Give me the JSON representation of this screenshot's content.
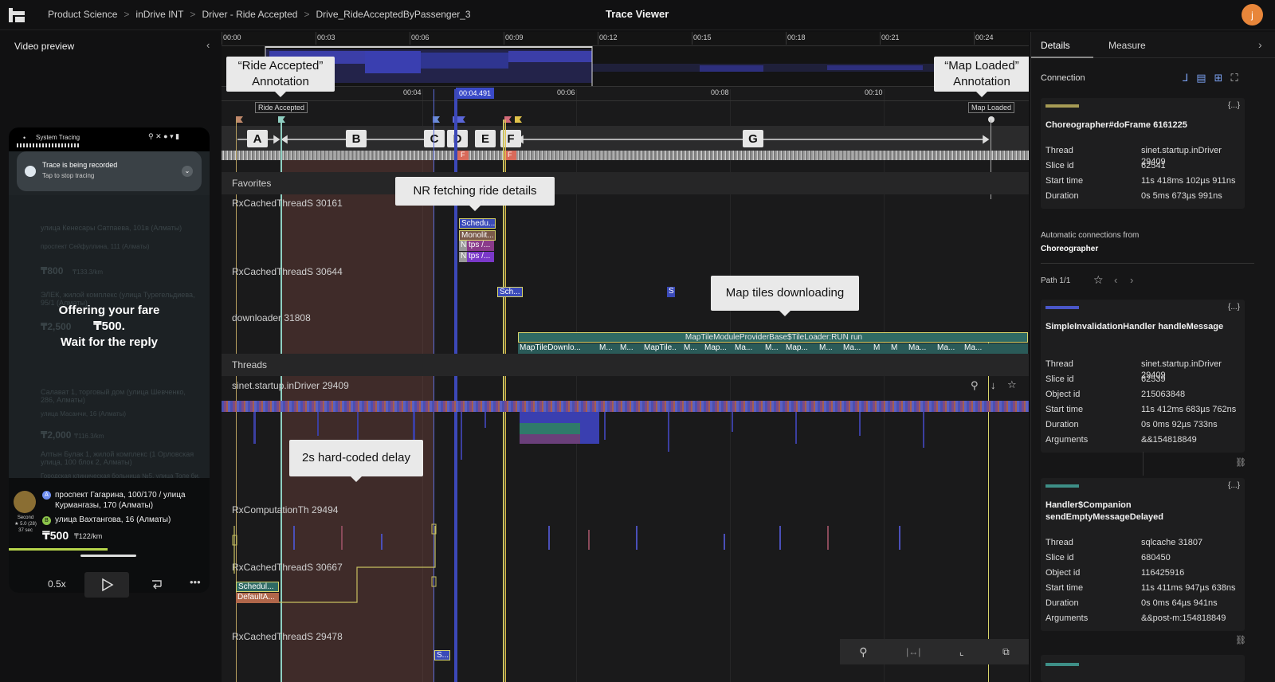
{
  "topbar": {
    "breadcrumbs": [
      "Product Science",
      "inDrive INT",
      "Driver - Ride Accepted",
      "Drive_RideAcceptedByPassenger_3"
    ],
    "title": "Trace Viewer",
    "avatar_initial": "j"
  },
  "video_preview": {
    "title": "Video preview",
    "speed": "0.5x",
    "phone": {
      "notif_app": "System Tracing",
      "notif_title": "Trace is being recorded",
      "notif_sub": "Tap to stop tracing",
      "offer_line1": "Offering your fare",
      "offer_line2": "₸500.",
      "offer_line3": "Wait for the reply",
      "bg_row1": "улица Кенесары Сатпаева, 101в (Алматы)",
      "bg_row1b": "проспект Сейфуллина, 111 (Алматы)",
      "bg_price1": "₸800",
      "bg_price1b": "₸133.3/km",
      "bg_row2": "ЭЛЕК, жилой комплекс (улица Турегельдиева, 95/1 (Алматы)",
      "bg_price2": "₸2,500",
      "bg_row3": "Салават 1, торговый дом (улица Шевченко, 286, Алматы)",
      "bg_row3b": "улица Масанчи, 16 (Алматы)",
      "bg_price3": "₸2,000",
      "bg_price3b": "₸116.3/km",
      "bg_row4": "Алтын Булак 1, жилой комплекс (1 Орловская улица, 100 блок 2, Алматы)",
      "bg_row4b": "Городская клиническая больница №5, улица Толе би, 253 (Алматы)",
      "driver_badge": "Second",
      "driver_rating": "★ 5.0 (28)",
      "driver_time": "37 sec",
      "from": "проспект Гагарина, 100/170 / улица Курмангазы, 170 (Алматы)",
      "to": "улица Вахтангова, 16 (Алматы)",
      "price": "₸500",
      "per_km": "₸122/km",
      "marker_a": "A",
      "marker_b": "B"
    }
  },
  "timeline": {
    "top_ticks": [
      "00:00",
      "00:03",
      "00:06",
      "00:09",
      "00:12",
      "00:15",
      "00:18",
      "00:21",
      "00:24"
    ],
    "zoom_ticks": [
      "00:04",
      "00:06",
      "00:08",
      "00:10"
    ],
    "cursor_time": "00:04.491",
    "annotations": {
      "ride_accepted": "Ride Accepted",
      "map_loaded": "Map Loaded"
    },
    "callouts": {
      "ride_accepted": "“Ride Accepted” Annotation",
      "map_loaded": "“Map Loaded” Annotation",
      "nr_fetch": "NR fetching ride details",
      "map_tiles": "Map tiles downloading",
      "delay": "2s hard-coded delay",
      "offering": "Offering your fare ₸500. Wait for the reply"
    },
    "segments": [
      "A",
      "B",
      "C",
      "D",
      "E",
      "F",
      "G"
    ],
    "sections": {
      "favorites": "Favorites",
      "threads": "Threads"
    },
    "tracks": {
      "rx30161": "RxCachedThreadS 30161",
      "rx30644": "RxCachedThreadS 30644",
      "downloader": "downloader 31808",
      "sinet": "sinet.startup.inDriver 29409",
      "rxcomp": "RxComputationTh 29494",
      "rx30667": "RxCachedThreadS 30667",
      "rx29478": "RxCachedThreadS 29478"
    },
    "slices": {
      "schedu1": "Schedu...",
      "monolit": "Monolit...",
      "n1": "N",
      "tps1": "tps /...",
      "n2": "N",
      "tps2": "tps /...",
      "sch": "Sch...",
      "s": "S",
      "maptile_main": "MapTileModuleProviderBase$TileLoader:RUN run",
      "maptile_sub": [
        "MapTileDownlo...",
        "M...",
        "M...",
        "MapTile...",
        "M...",
        "Map...",
        "Ma...",
        "M...",
        "Map...",
        "M...",
        "Ma...",
        "M",
        "M",
        "Ma...",
        "Ma...",
        "Ma..."
      ],
      "schedul": "Schedul...",
      "defaulta": "DefaultA...",
      "s2": "S..."
    },
    "f_marker": "F"
  },
  "details": {
    "tabs": [
      "Details",
      "Measure"
    ],
    "connection_label": "Connection",
    "auto_label": "Automatic connections from",
    "auto_source": "Choreographer",
    "path_label": "Path 1/1",
    "ref_label": "{...}",
    "cards": [
      {
        "color": "#a79c55",
        "title": "Choreographer#doFrame 6161225",
        "rows": [
          [
            "Thread",
            "sinet.startup.inDriver 29409"
          ],
          [
            "Slice id",
            "62541"
          ],
          [
            "Start time",
            "11s 418ms 102µs 911ns"
          ],
          [
            "Duration",
            "0s 5ms 673µs 991ns"
          ]
        ]
      },
      {
        "color": "#4a57c9",
        "title": "SimpleInvalidationHandler handleMessage",
        "rows": [
          [
            "Thread",
            "sinet.startup.inDriver 29409"
          ],
          [
            "Slice id",
            "62539"
          ],
          [
            "Object id",
            "215063848"
          ],
          [
            "Start time",
            "11s 412ms 683µs 762ns"
          ],
          [
            "Duration",
            "0s 0ms 92µs 733ns"
          ],
          [
            "Arguments",
            "&&154818849"
          ]
        ]
      },
      {
        "color": "#3e8f87",
        "title": "Handler$Companion sendEmptyMessageDelayed",
        "rows": [
          [
            "Thread",
            "sqlcache 31807"
          ],
          [
            "Slice id",
            "680450"
          ],
          [
            "Object id",
            "116425916"
          ],
          [
            "Start time",
            "11s 411ms 947µs 638ns"
          ],
          [
            "Duration",
            "0s 0ms 64µs 941ns"
          ],
          [
            "Arguments",
            "&&post-m:154818849"
          ]
        ]
      }
    ]
  }
}
